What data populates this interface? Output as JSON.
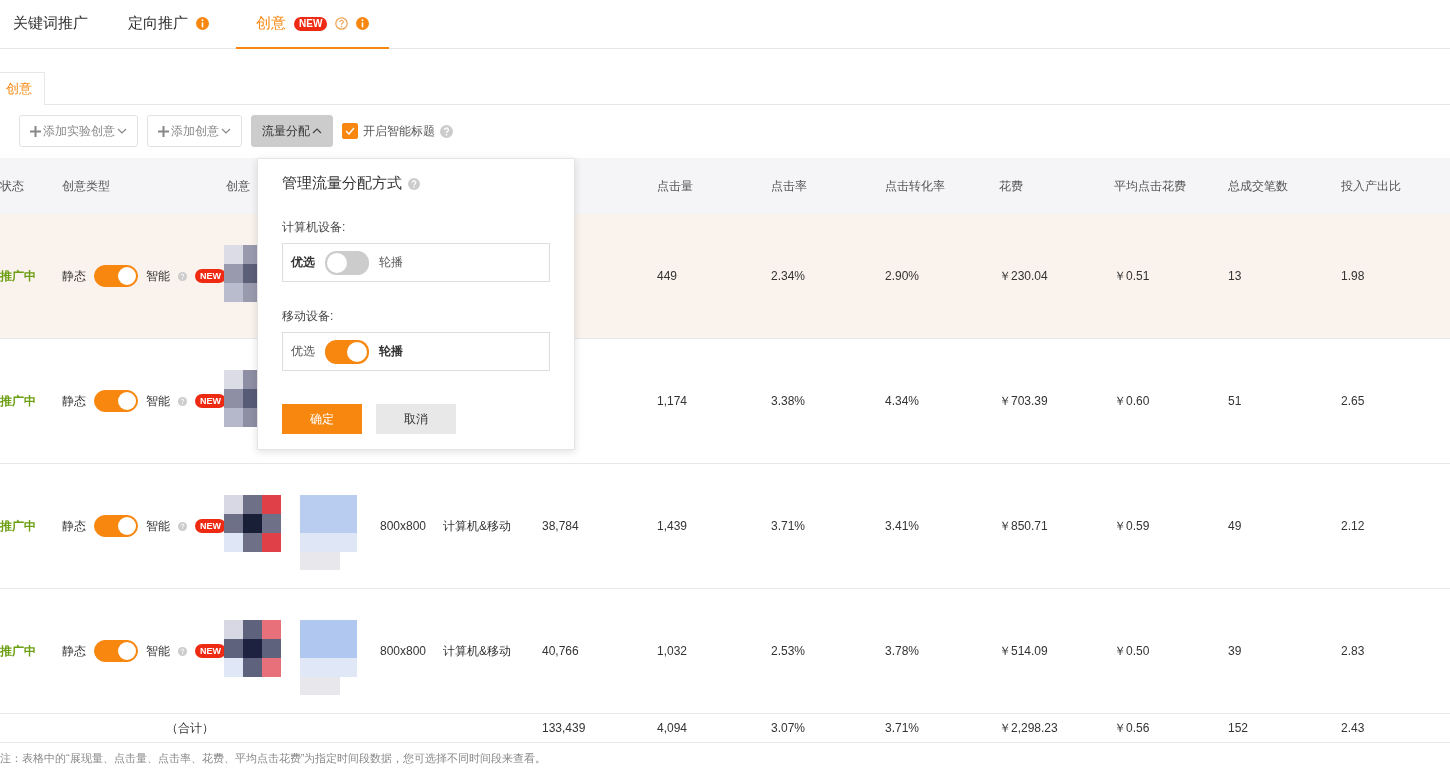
{
  "tabs": [
    {
      "label": "关键词推广",
      "selected": false,
      "help": false,
      "info": false
    },
    {
      "label": "定向推广",
      "selected": false,
      "help": false,
      "info": true
    },
    {
      "label": "创意",
      "selected": true,
      "badge": "NEW",
      "help": true,
      "info": true
    }
  ],
  "subtabs": [
    {
      "label": "创意",
      "selected": true
    }
  ],
  "toolbar": {
    "buttons": [
      {
        "kind": "dropdown",
        "label": "添加实验创意",
        "open": false
      },
      {
        "kind": "dropdown",
        "label": "添加创意",
        "open": false
      },
      {
        "kind": "toggle",
        "label": "流量分配",
        "open": true
      }
    ],
    "smart_title": {
      "label": "开启智能标题",
      "checked": true
    }
  },
  "table": {
    "columns_left": [
      "状态",
      "创意类型",
      "创意"
    ],
    "columns_right": [
      "点击量",
      "点击率",
      "点击转化率",
      "花费",
      "平均点击花费",
      "总成交笔数",
      "投入产出比"
    ],
    "rows": [
      {
        "highlighted": true,
        "status": "推广中",
        "type_left": "静态",
        "on": true,
        "type_right": "智能",
        "badge": "NEW",
        "clicks": "449",
        "ctr": "2.34%",
        "cvr": "2.90%",
        "cost": "￥230.04",
        "cpc": "￥0.51",
        "orders": "13",
        "roi": "1.98"
      },
      {
        "highlighted": false,
        "status": "推广中",
        "type_left": "静态",
        "on": true,
        "type_right": "智能",
        "badge": "NEW",
        "clicks": "1,174",
        "ctr": "3.38%",
        "cvr": "4.34%",
        "cost": "￥703.39",
        "cpc": "￥0.60",
        "orders": "51",
        "roi": "2.65"
      },
      {
        "highlighted": false,
        "status": "推广中",
        "type_left": "静态",
        "on": true,
        "type_right": "智能",
        "badge": "NEW",
        "size": "800x800",
        "device": "计算机&移动",
        "impressions": "38,784",
        "clicks": "1,439",
        "ctr": "3.71%",
        "cvr": "3.41%",
        "cost": "￥850.71",
        "cpc": "￥0.59",
        "orders": "49",
        "roi": "2.12"
      },
      {
        "highlighted": false,
        "status": "推广中",
        "type_left": "静态",
        "on": true,
        "type_right": "智能",
        "badge": "NEW",
        "size": "800x800",
        "device": "计算机&移动",
        "impressions": "40,766",
        "clicks": "1,032",
        "ctr": "2.53%",
        "cvr": "3.78%",
        "cost": "￥514.09",
        "cpc": "￥0.50",
        "orders": "39",
        "roi": "2.83"
      }
    ],
    "total": {
      "label": "（合计）",
      "impressions": "133,439",
      "clicks": "4,094",
      "ctr": "3.07%",
      "cvr": "3.71%",
      "cost": "￥2,298.23",
      "cpc": "￥0.56",
      "orders": "152",
      "roi": "2.43"
    }
  },
  "note": "注：表格中的“展现量、点击量、点击率、花费、平均点击花费”为指定时间段数据，您可选择不同时间段来查看。",
  "popup": {
    "title": "管理流量分配方式",
    "devices": [
      {
        "label": "计算机设备:",
        "left": "优选",
        "right": "轮播",
        "on": false
      },
      {
        "label": "移动设备:",
        "left": "优选",
        "right": "轮播",
        "on": true
      }
    ],
    "buttons": [
      {
        "kind": "primary",
        "label": "确定"
      },
      {
        "kind": "secondary",
        "label": "取消"
      }
    ]
  }
}
